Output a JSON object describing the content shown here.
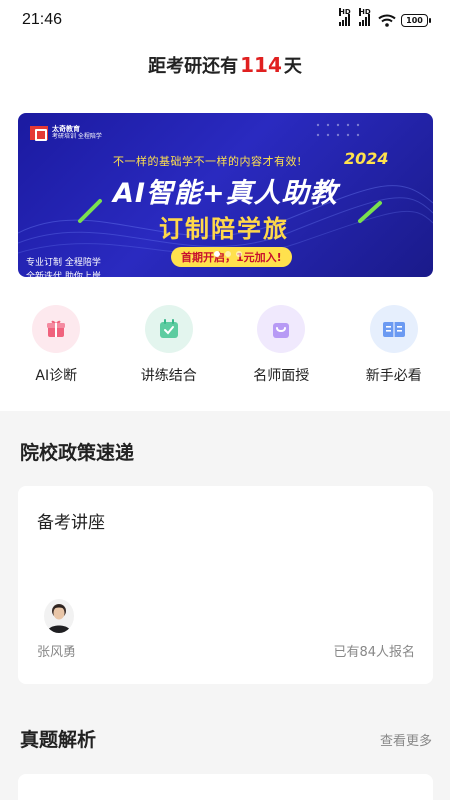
{
  "status_bar": {
    "time": "21:46",
    "battery": "100"
  },
  "countdown": {
    "prefix": "距考研还有",
    "days": "114",
    "suffix": "天"
  },
  "banner": {
    "logo_name": "太奇教育",
    "logo_slogan": "考研培训 全程陪学",
    "subtitle": "不一样的基础学不一样的内容才有效!",
    "year": "2024",
    "headline": "AI智能+真人助教",
    "headline2": "订制陪学旅",
    "pill": "首期开启，1元加入!",
    "left_line1": "专业订制  全程陪学",
    "left_line2": "全新迭代  助你上岸",
    "slide_count": 3,
    "active_slide": 1
  },
  "quick_entries": [
    {
      "label": "AI诊断",
      "icon": "gift-icon",
      "bg": "#fde9ee",
      "color": "#f0627d"
    },
    {
      "label": "讲练结合",
      "icon": "calendar-check-icon",
      "bg": "#e3f5ee",
      "color": "#37b889"
    },
    {
      "label": "名师面授",
      "icon": "shopping-bag-icon",
      "bg": "#f0e9fd",
      "color": "#a887f2"
    },
    {
      "label": "新手必看",
      "icon": "book-icon",
      "bg": "#e6effd",
      "color": "#5c8ff0"
    }
  ],
  "policy_section": {
    "title": "院校政策速递"
  },
  "lecture_card": {
    "title": "备考讲座",
    "teacher": "张风勇",
    "signed": "已有84人报名"
  },
  "exam_section": {
    "title": "真题解析",
    "more": "查看更多"
  }
}
